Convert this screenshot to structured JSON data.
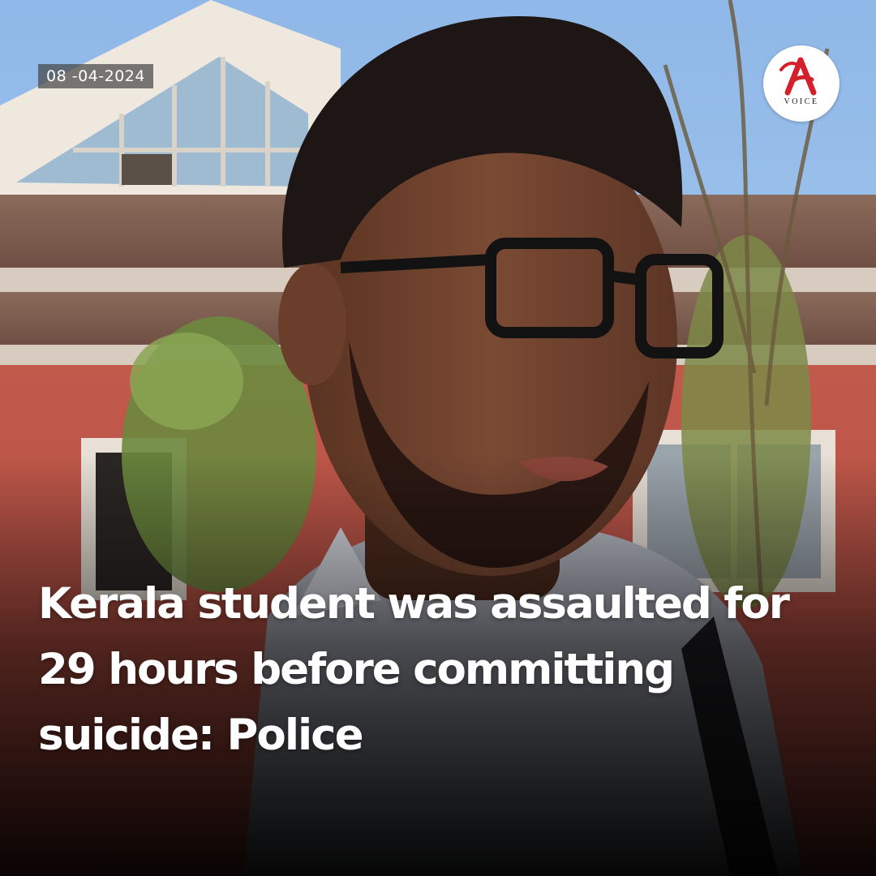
{
  "post": {
    "date": "08 -04-2024",
    "headline_lines": [
      "Kerala student was assaulted for",
      "29 hours before committing",
      "suicide: Police"
    ]
  },
  "brand": {
    "logo_letter": "A",
    "logo_word": "VOICE",
    "accent_color": "#d4202a"
  },
  "photo": {
    "icon": "portrait-photo"
  }
}
